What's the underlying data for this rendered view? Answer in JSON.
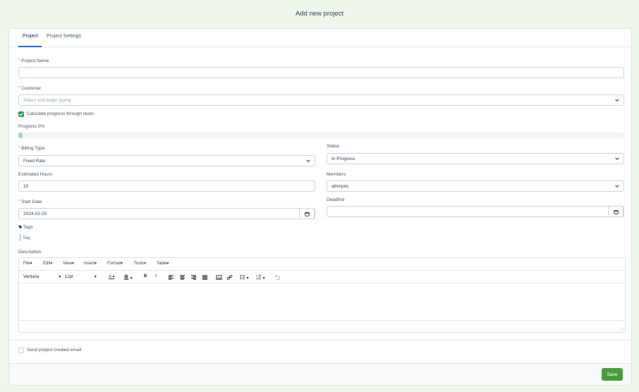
{
  "page": {
    "title": "Add new project"
  },
  "tabs": [
    "Project",
    "Project Settings"
  ],
  "form": {
    "project_name": {
      "label": "Project Name",
      "value": ""
    },
    "customer": {
      "label": "Customer",
      "placeholder": "Select and begin typing"
    },
    "calc_progress": {
      "label": "Calculate progress through tasks",
      "checked": true
    },
    "progress": {
      "label": "Progress 0%",
      "value": 0
    },
    "billing_type": {
      "label": "Billing Type",
      "value": "Fixed Rate"
    },
    "status": {
      "label": "Status",
      "value": "In Progress"
    },
    "estimated_hours": {
      "label": "Estimated Hours",
      "value": "10"
    },
    "members": {
      "label": "Members",
      "value": "athinjots"
    },
    "start_date": {
      "label": "Start Date",
      "value": "2024-02-20"
    },
    "deadline": {
      "label": "Deadline",
      "value": ""
    },
    "tags": {
      "label": "Tags",
      "placeholder": "Tag"
    },
    "description": {
      "label": "Description"
    },
    "send_email": {
      "label": "Send project created email",
      "checked": false
    }
  },
  "editor": {
    "menus": [
      "File",
      "Edit",
      "View",
      "Insert",
      "Format",
      "Tools",
      "Table"
    ],
    "font_family": "Verdana",
    "font_size": "12pt",
    "toolbar_icons": [
      "text-color-icon",
      "highlight-icon",
      "bold-icon",
      "italic-icon",
      "align-left-icon",
      "align-center-icon",
      "align-right-icon",
      "align-justify-icon",
      "image-icon",
      "link-icon",
      "bullet-list-icon",
      "numbered-list-icon",
      "undo-icon"
    ],
    "bold_glyph": "B",
    "italic_glyph": "I",
    "text_color_glyph": "A"
  },
  "footer": {
    "save_label": "Save"
  },
  "colors": {
    "accent": "#2563eb",
    "save": "#4a9d3c",
    "check": "#22a04a",
    "progress": "#a7dfb4"
  }
}
